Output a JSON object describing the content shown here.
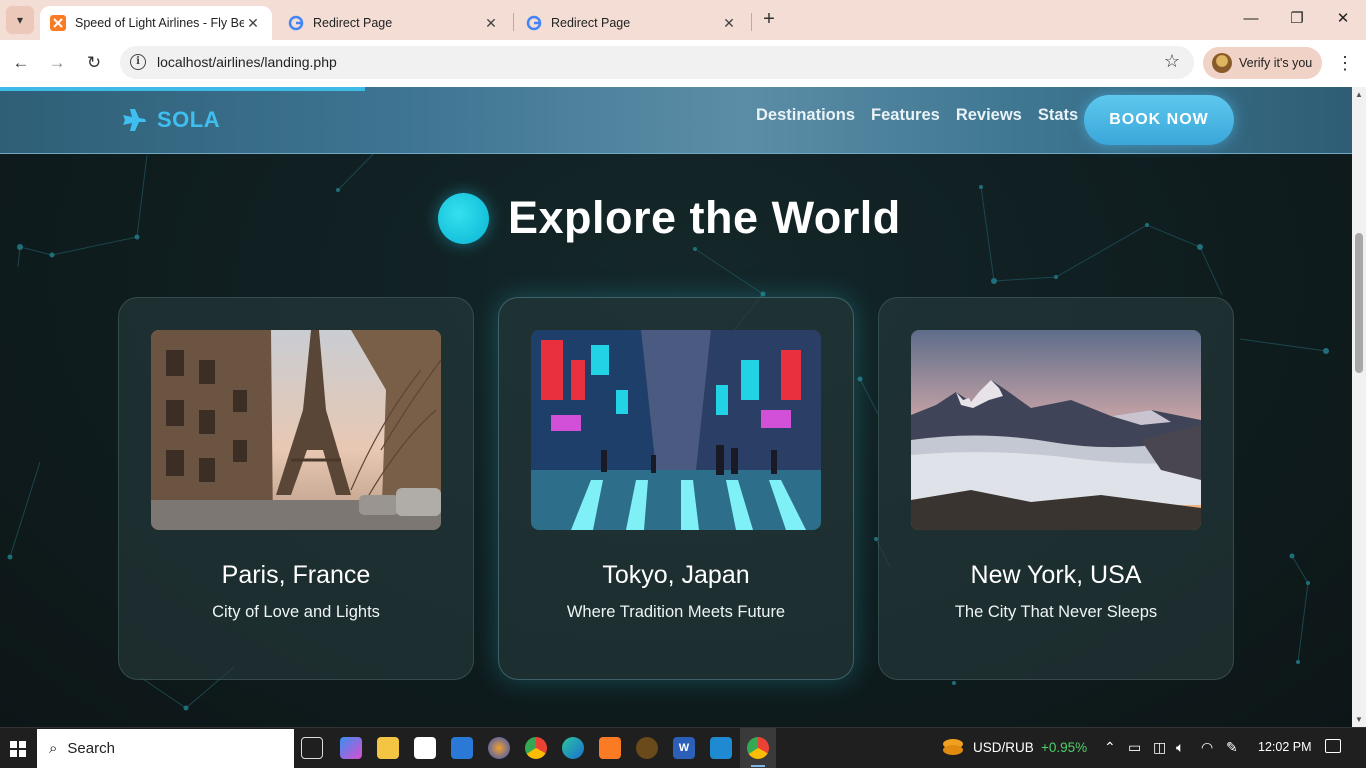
{
  "browser": {
    "tabs": [
      {
        "title": "Speed of Light Airlines - Fly Bey",
        "active": true,
        "favicon": "xampp-icon"
      },
      {
        "title": "Redirect Page",
        "active": false,
        "favicon": "google-icon"
      },
      {
        "title": "Redirect Page",
        "active": false,
        "favicon": "google-icon"
      }
    ],
    "url": "localhost/airlines/landing.php",
    "profile_label": "Verify it's you",
    "close_glyph": "✕",
    "new_tab_glyph": "+"
  },
  "site": {
    "logo_text": "SOLA",
    "nav": [
      "Destinations",
      "Features",
      "Reviews",
      "Stats"
    ],
    "cta": "BOOK NOW",
    "scroll_progress": 0.27,
    "section_title": "Explore the World",
    "destinations": [
      {
        "city": "Paris, France",
        "tagline": "City of Love and Lights",
        "image": "eiffel-tower-photo"
      },
      {
        "city": "Tokyo, Japan",
        "tagline": "Where Tradition Meets Future",
        "image": "tokyo-street-photo"
      },
      {
        "city": "New York, USA",
        "tagline": "The City That Never Sleeps",
        "image": "mountain-clouds-photo"
      }
    ]
  },
  "taskbar": {
    "search_label": "Search",
    "ticker_label": "USD/RUB",
    "ticker_change": "+0.95%",
    "clock": "12:02 PM"
  },
  "colors": {
    "accent": "#3fbff0",
    "title_dot": "#16c2dc",
    "page_bg": "#10191b",
    "ticker_positive": "#4fcf6a"
  }
}
